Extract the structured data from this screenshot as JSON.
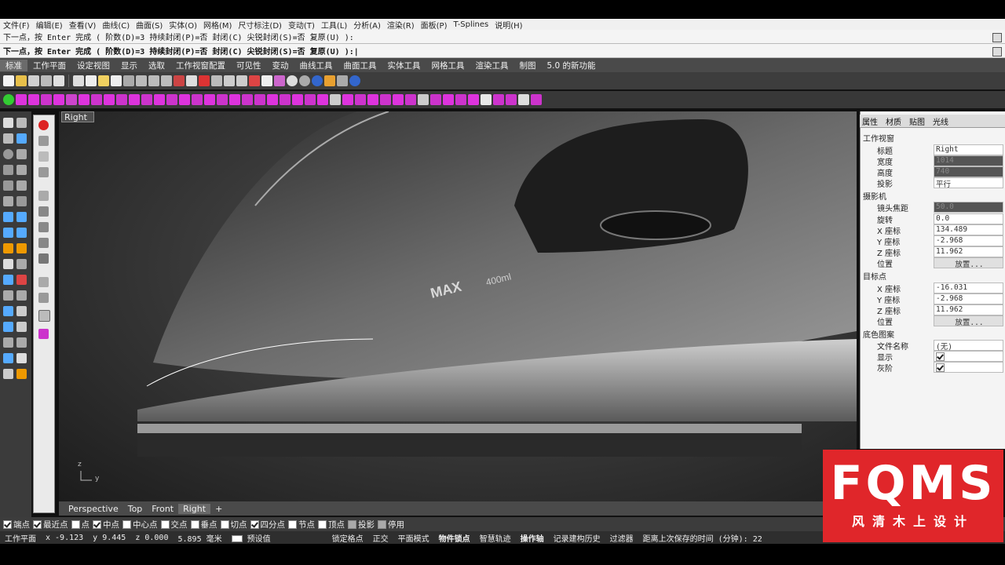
{
  "menu": [
    "文件(F)",
    "编辑(E)",
    "查看(V)",
    "曲线(C)",
    "曲面(S)",
    "实体(O)",
    "网格(M)",
    "尺寸标注(D)",
    "变动(T)",
    "工具(L)",
    "分析(A)",
    "渲染(R)",
    "面板(P)",
    "T-Splines",
    "说明(H)"
  ],
  "command": {
    "history": "下一点，按 Enter 完成 ( 阶数(D)=3  持续封闭(P)=否  封闭(C)  尖锐封闭(S)=否  复原(U) ):",
    "prompt": "下一点，按 Enter 完成 ( 阶数(D)=3  持续封闭(P)=否  封闭(C)  尖锐封闭(S)=否  复原(U) ):|"
  },
  "toolbar_tabs": [
    "标准",
    "工作平面",
    "设定视图",
    "显示",
    "选取",
    "工作视窗配置",
    "可见性",
    "变动",
    "曲线工具",
    "曲面工具",
    "实体工具",
    "网格工具",
    "渲染工具",
    "制图",
    "5.0 的新功能"
  ],
  "active_tab_index": 0,
  "viewport": {
    "label": "Right",
    "model_text": "MAX",
    "model_subtext": "400ml",
    "axis_z": "z",
    "axis_y": "y",
    "tabs": [
      "Perspective",
      "Top",
      "Front",
      "Right"
    ],
    "active_tab_index": 3,
    "add_tab_icon": "+"
  },
  "properties": {
    "tabs": [
      "属性",
      "材质",
      "贴图",
      "光线"
    ],
    "section_viewport": "工作视窗",
    "title_label": "标题",
    "title_value": "Right",
    "width_label": "宽度",
    "width_value": "1014",
    "height_label": "高度",
    "height_value": "740",
    "projection_label": "投影",
    "projection_value": "平行",
    "section_camera": "摄影机",
    "focal_label": "镜头焦距",
    "focal_value": "50.0",
    "rotation_label": "旋转",
    "rotation_value": "0.0",
    "cam_x_label": "X 座标",
    "cam_x_value": "134.489",
    "cam_y_label": "Y 座标",
    "cam_y_value": "-2.968",
    "cam_z_label": "Z 座标",
    "cam_z_value": "11.962",
    "cam_pos_label": "位置",
    "place_button": "放置...",
    "section_target": "目标点",
    "tgt_x_label": "X 座标",
    "tgt_x_value": "-16.031",
    "tgt_y_label": "Y 座标",
    "tgt_y_value": "-2.968",
    "tgt_z_label": "Z 座标",
    "tgt_z_value": "11.962",
    "tgt_pos_label": "位置",
    "section_wallpaper": "底色图案",
    "filename_label": "文件名称",
    "filename_value": "(无)",
    "browse_button": "...",
    "show_label": "显示",
    "gray_label": "灰阶"
  },
  "osnaps": [
    {
      "label": "端点",
      "checked": true
    },
    {
      "label": "最近点",
      "checked": true
    },
    {
      "label": "点",
      "checked": false
    },
    {
      "label": "中点",
      "checked": true
    },
    {
      "label": "中心点",
      "checked": false
    },
    {
      "label": "交点",
      "checked": false
    },
    {
      "label": "垂点",
      "checked": false
    },
    {
      "label": "切点",
      "checked": false
    },
    {
      "label": "四分点",
      "checked": true
    },
    {
      "label": "节点",
      "checked": false
    },
    {
      "label": "顶点",
      "checked": false
    },
    {
      "label": "投影",
      "checked": false,
      "disabled": true
    },
    {
      "label": "停用",
      "checked": false,
      "disabled": true
    }
  ],
  "status": {
    "plane": "工作平面",
    "x": "x -9.123",
    "y": "y 9.445",
    "z": "z 0.000",
    "unit": "5.895 毫米",
    "default_layer": "预设值",
    "grid_snap": "锁定格点",
    "ortho": "正交",
    "planar": "平面模式",
    "osnap": "物件锁点",
    "smarttrack": "智慧轨迹",
    "gumball": "操作轴",
    "history": "记录建构历史",
    "filter": "过滤器",
    "autosave": "距离上次保存的时间 (分钟): 22"
  },
  "watermark": {
    "big": "FQMS",
    "small": "风清木上设计"
  },
  "colors": {
    "accent": "#e0262a",
    "panel": "#f4f4f4",
    "toolbar": "#3d3d3d"
  }
}
